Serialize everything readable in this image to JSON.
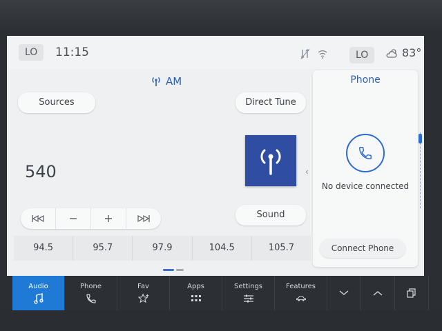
{
  "status": {
    "climate_left": "LO",
    "time": "11:15",
    "climate_right": "LO",
    "temperature": "83°",
    "icons": [
      "no-signal-icon",
      "wifi-icon",
      "cloud-sun-icon"
    ]
  },
  "audio": {
    "source_name": "AM",
    "sources_button": "Sources",
    "direct_tune_button": "Direct Tune",
    "frequency": "540",
    "sound_button": "Sound",
    "controls": [
      "seek-back-icon",
      "minus-icon",
      "plus-icon",
      "seek-forward-icon"
    ],
    "presets": [
      "94.5",
      "95.7",
      "97.9",
      "104.5",
      "105.7"
    ]
  },
  "phone_panel": {
    "title": "Phone",
    "status": "No device connected",
    "connect_button": "Connect Phone"
  },
  "nav": {
    "items": [
      {
        "label": "Audio",
        "icon": "music-note-icon",
        "active": true
      },
      {
        "label": "Phone",
        "icon": "phone-icon"
      },
      {
        "label": "Fav",
        "icon": "star-plus-icon"
      },
      {
        "label": "Apps",
        "icon": "grid-icon"
      },
      {
        "label": "Settings",
        "icon": "sliders-icon"
      },
      {
        "label": "Features",
        "icon": "car-icon"
      }
    ],
    "extra_icons": [
      "chevron-down-icon",
      "chevron-up-icon",
      "copy-screens-icon"
    ]
  },
  "colors": {
    "accent": "#2f6bd6",
    "nav_active": "#1f7ad6",
    "album_art": "#2e4da3"
  }
}
